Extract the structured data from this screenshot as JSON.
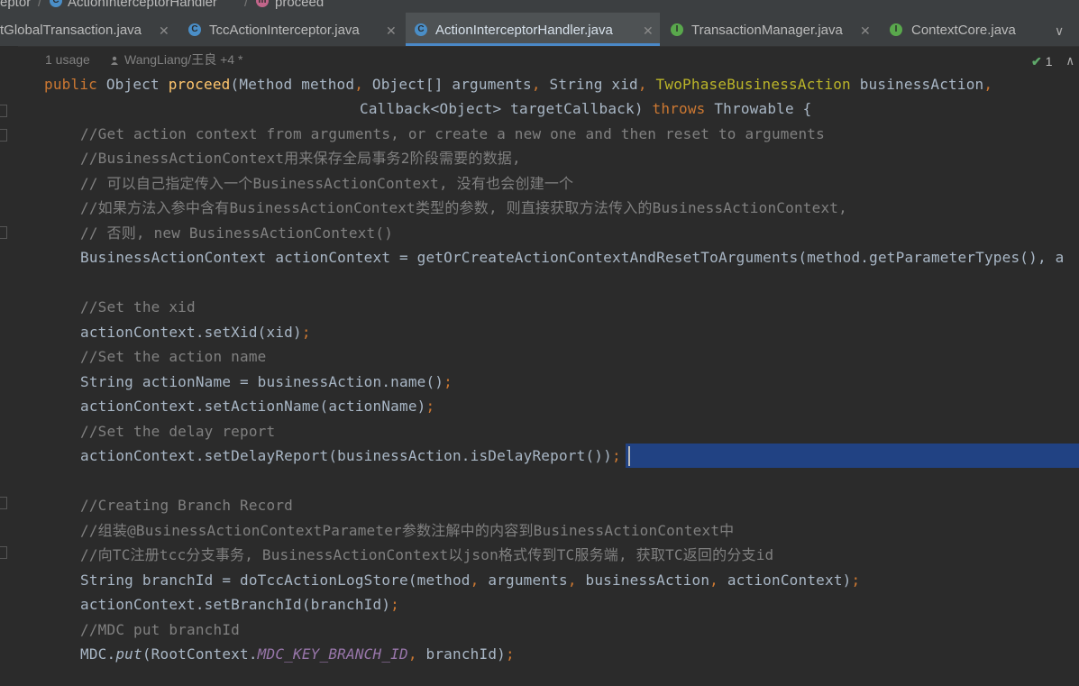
{
  "breadcrumb": {
    "items": [
      "eptor",
      "ActionInterceptorHandler",
      "proceed"
    ]
  },
  "tabs": [
    {
      "label": "tGlobalTransaction.java",
      "icon": "",
      "active": false
    },
    {
      "label": "TccActionInterceptor.java",
      "icon": "C",
      "active": false
    },
    {
      "label": "ActionInterceptorHandler.java",
      "icon": "C",
      "active": true
    },
    {
      "label": "TransactionManager.java",
      "icon": "I",
      "active": false
    },
    {
      "label": "ContextCore.java",
      "icon": "I",
      "active": false
    }
  ],
  "tab_close_glyph": "✕",
  "tabs_overflow_glyph": "∨",
  "inlay": {
    "usages": "1 usage",
    "author": "WangLiang/王良 +4 *"
  },
  "inspection": {
    "count": "1"
  },
  "colors": {
    "keyword": "#cc7832",
    "method": "#ffc66d",
    "comment": "#808080",
    "annotation": "#bbb529",
    "static_field": "#9876aa",
    "selection": "#214283",
    "background": "#2b2b2b"
  },
  "code": {
    "sig1": {
      "kw": "public ",
      "type": "Object ",
      "name": "proceed",
      "rest_a": "(Method method",
      "c1": ", ",
      "rest_b": "Object[] arguments",
      "c2": ", ",
      "rest_c": "String xid",
      "c3": ", ",
      "ann": "TwoPhaseBusinessAction ",
      "rest_d": "businessAction",
      "c4": ","
    },
    "sig2": {
      "text": "Callback<Object> targetCallback) ",
      "kw": "throws ",
      "rest": "Throwable {"
    },
    "c1": "//Get action context from arguments, or create a new one and then reset to arguments",
    "c2": "//BusinessActionContext用来保存全局事务2阶段需要的数据,",
    "c3": "// 可以自己指定传入一个BusinessActionContext, 没有也会创建一个",
    "c4": "//如果方法入参中含有BusinessActionContext类型的参数, 则直接获取方法传入的BusinessActionContext,",
    "c5": "// 否则, new BusinessActionContext()",
    "l6": "BusinessActionContext actionContext = getOrCreateActionContextAndResetToArguments(method.getParameterTypes(), a",
    "c7": "//Set the xid",
    "l8": {
      "text": "actionContext.setXid(xid)",
      "semi": ";"
    },
    "c9": "//Set the action name",
    "l10": {
      "text": "String actionName = businessAction.name()",
      "semi": ";"
    },
    "l11": {
      "text": "actionContext.setActionName(actionName)",
      "semi": ";"
    },
    "c12": "//Set the delay report",
    "l13": {
      "text": "actionContext.setDelayReport(businessAction.isDelayReport())",
      "semi": ";"
    },
    "c14": "//Creating Branch Record",
    "c15": "//组装@BusinessActionContextParameter参数注解中的内容到BusinessActionContext中",
    "c16": "//向TC注册tcc分支事务, BusinessActionContext以json格式传到TC服务端, 获取TC返回的分支id",
    "l17": {
      "a": "String branchId = doTccActionLogStore(method",
      "c1": ", ",
      "b": "arguments",
      "c2": ", ",
      "c": "businessAction",
      "c3": ", ",
      "d": "actionContext)",
      "semi": ";"
    },
    "l18": {
      "text": "actionContext.setBranchId(branchId)",
      "semi": ";"
    },
    "c19": "//MDC put branchId",
    "l20": {
      "a": "MDC.",
      "m": "put",
      "b": "(RootContext.",
      "f": "MDC_KEY_BRANCH_ID",
      "c": ", ",
      "d": "branchId)",
      "semi": ";"
    }
  }
}
